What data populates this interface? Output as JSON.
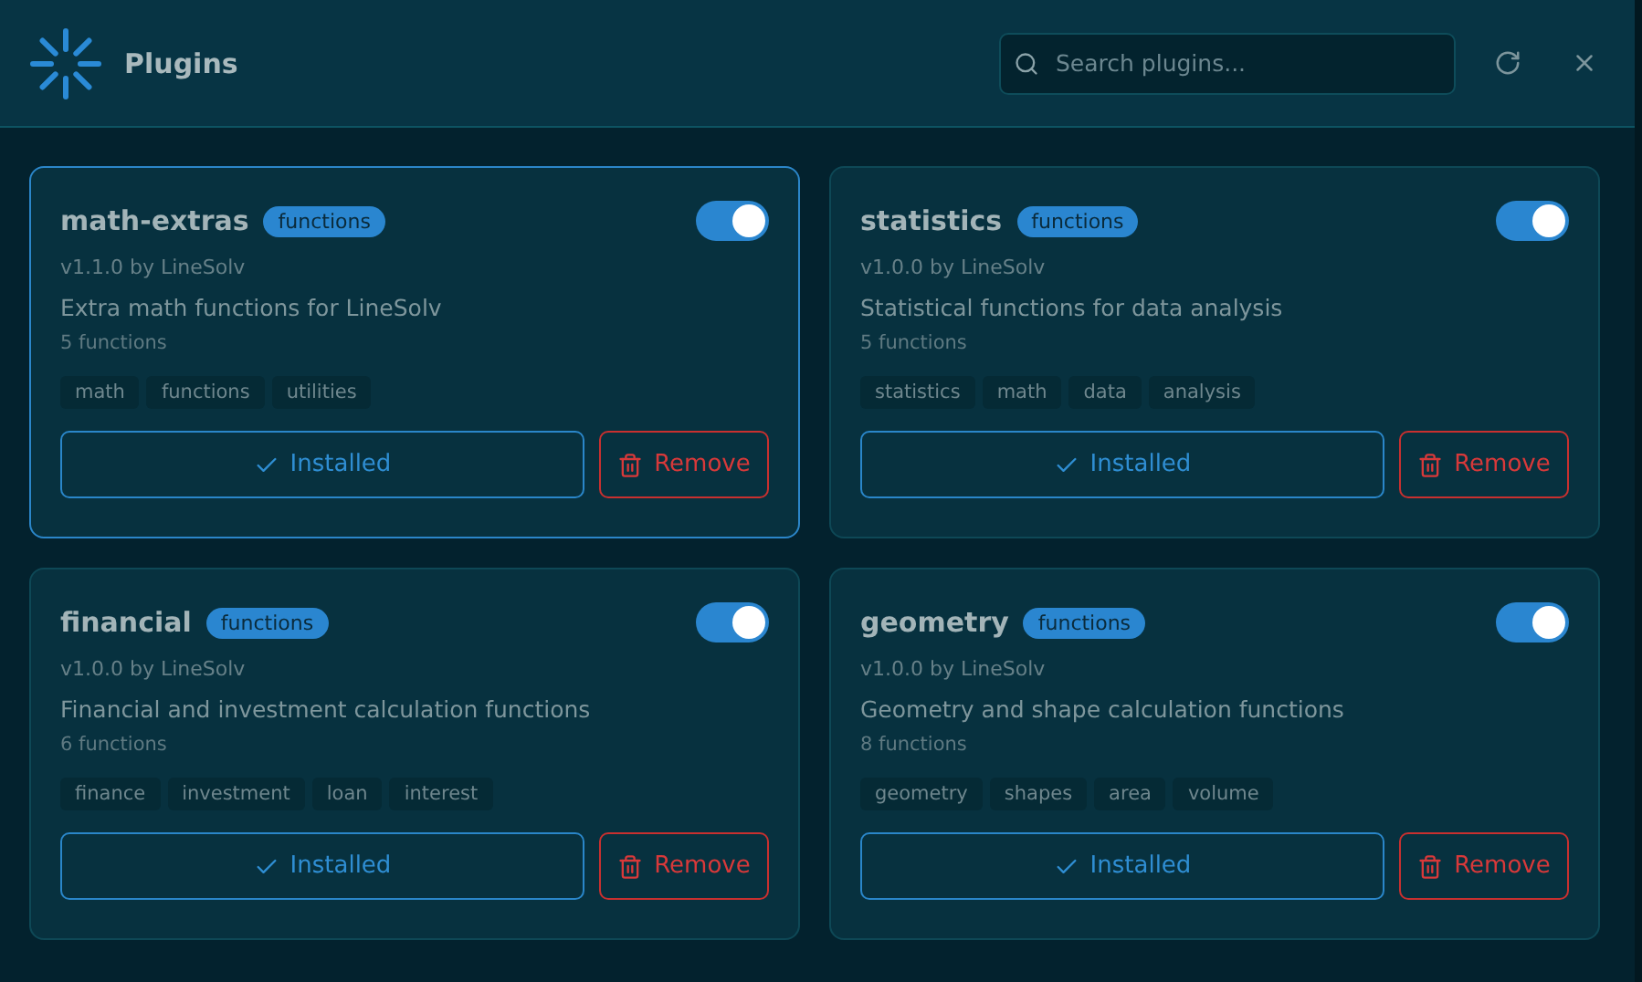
{
  "header": {
    "title": "Plugins",
    "search": {
      "placeholder": "Search plugins..."
    }
  },
  "plugins": [
    {
      "name": "math-extras",
      "category": "functions",
      "enabled": true,
      "selected": true,
      "meta": "v1.1.0 by LineSolv",
      "description": "Extra math functions for LineSolv",
      "count": "5 functions",
      "tags": [
        "math",
        "functions",
        "utilities"
      ],
      "installed_label": "Installed",
      "remove_label": "Remove"
    },
    {
      "name": "statistics",
      "category": "functions",
      "enabled": true,
      "selected": false,
      "meta": "v1.0.0 by LineSolv",
      "description": "Statistical functions for data analysis",
      "count": "5 functions",
      "tags": [
        "statistics",
        "math",
        "data",
        "analysis"
      ],
      "installed_label": "Installed",
      "remove_label": "Remove"
    },
    {
      "name": "financial",
      "category": "functions",
      "enabled": true,
      "selected": false,
      "meta": "v1.0.0 by LineSolv",
      "description": "Financial and investment calculation functions",
      "count": "6 functions",
      "tags": [
        "finance",
        "investment",
        "loan",
        "interest"
      ],
      "installed_label": "Installed",
      "remove_label": "Remove"
    },
    {
      "name": "geometry",
      "category": "functions",
      "enabled": true,
      "selected": false,
      "meta": "v1.0.0 by LineSolv",
      "description": "Geometry and shape calculation functions",
      "count": "8 functions",
      "tags": [
        "geometry",
        "shapes",
        "area",
        "volume"
      ],
      "installed_label": "Installed",
      "remove_label": "Remove"
    }
  ]
}
